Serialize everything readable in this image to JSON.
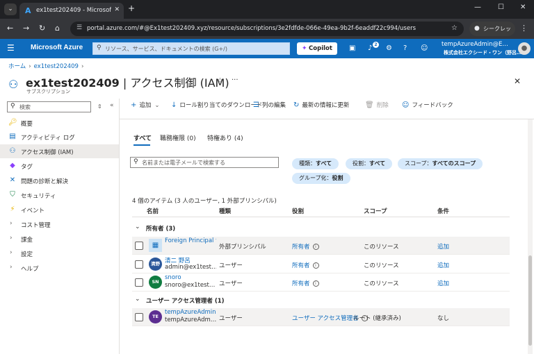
{
  "browser": {
    "tab_title": "ex1test202409 - Microsoft Azure",
    "url": "portal.azure.com/#@Ex1test202409.xyz/resource/subscriptions/3e2fdfde-066e-49ea-9b2f-6eaddf22c994/users",
    "incognito_label": "シークレット"
  },
  "azure": {
    "brand": "Microsoft Azure",
    "search_placeholder": "リソース、サービス、ドキュメントの検索 (G+/)",
    "copilot_label": "Copilot",
    "notification_count": "2",
    "user_name": "tempAzureAdmin@E…",
    "user_org": "株式会社エクシード・ワン（野呂…"
  },
  "page": {
    "breadcrumb_home": "ホーム",
    "breadcrumb_item": "ex1test202409",
    "title_resource": "ex1test202409",
    "title_sep": " | ",
    "title_blade": "アクセス制御 (IAM)",
    "subtitle": "サブスクリプション"
  },
  "sidebar": {
    "search_placeholder": "検索",
    "items": [
      {
        "label": "概要",
        "icon": "key-icon"
      },
      {
        "label": "アクティビティ ログ",
        "icon": "activity-log-icon"
      },
      {
        "label": "アクセス制御 (IAM)",
        "icon": "people-icon"
      },
      {
        "label": "タグ",
        "icon": "tag-icon"
      },
      {
        "label": "問題の診断と解決",
        "icon": "wrench-icon"
      },
      {
        "label": "セキュリティ",
        "icon": "shield-icon"
      },
      {
        "label": "イベント",
        "icon": "lightning-icon"
      },
      {
        "label": "コスト管理",
        "icon": "chevron-right-icon"
      },
      {
        "label": "課金",
        "icon": "chevron-right-icon"
      },
      {
        "label": "設定",
        "icon": "chevron-right-icon"
      },
      {
        "label": "ヘルプ",
        "icon": "chevron-right-icon"
      }
    ]
  },
  "command_bar": {
    "add": "追加",
    "download": "ロール割り当てのダウンロード",
    "edit_columns": "列の編集",
    "refresh": "最新の情報に更新",
    "delete": "削除",
    "feedback": "フィードバック"
  },
  "tabs": [
    {
      "label": "すべて"
    },
    {
      "label": "職務権限 (0)"
    },
    {
      "label": "特権あり (4)"
    }
  ],
  "filters": {
    "search_placeholder": "名前または電子メールで検索する",
    "pills": [
      {
        "key": "種類：",
        "value": "すべて"
      },
      {
        "key": "役割：",
        "value": "すべて"
      },
      {
        "key": "スコープ：",
        "value": "すべてのスコープ"
      },
      {
        "key": "グループ化：",
        "value": "役割"
      }
    ]
  },
  "table": {
    "count_text": "4 個のアイテム (3 人のユーザー, 1 外部プリンシパル)",
    "headers": {
      "name": "名前",
      "type": "種類",
      "role": "役割",
      "scope": "スコープ",
      "condition": "条件"
    },
    "groups": [
      {
        "label": "所有者 (3)"
      },
      {
        "label": "ユーザー アクセス管理者 (1)"
      }
    ],
    "rows": [
      {
        "initials": "",
        "name": "Foreign Principal f",
        "sub": "",
        "type": "外部プリンシパル",
        "role": "所有者",
        "scope": "このリソース",
        "condition": "追加"
      },
      {
        "initials": "清野",
        "name": "清二 野呂",
        "sub": "admin@ex1test…",
        "type": "ユーザー",
        "role": "所有者",
        "scope": "このリソース",
        "condition": "追加"
      },
      {
        "initials": "SN",
        "name": "snoro",
        "sub": "snoro@ex1test…",
        "type": "ユーザー",
        "role": "所有者",
        "scope": "このリソース",
        "condition": "追加"
      },
      {
        "initials": "TE",
        "name": "tempAzureAdmin",
        "sub": "tempAzureAdm…",
        "type": "ユーザー",
        "role": "ユーザー アクセス管理者",
        "scope": "ルート (継承済み)",
        "condition": "なし"
      }
    ]
  },
  "colors": {
    "azure_blue": "#0f6cbd",
    "avatar_blue": "#2b579a",
    "avatar_green": "#107c41",
    "avatar_purple": "#5c2e91"
  }
}
